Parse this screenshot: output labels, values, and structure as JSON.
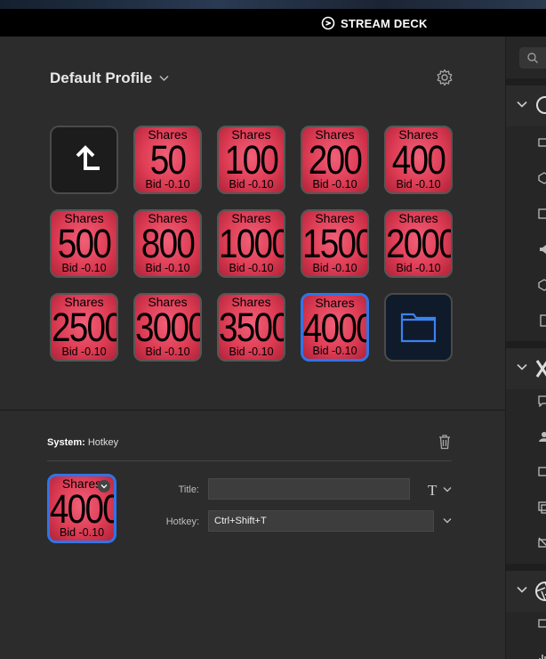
{
  "app": {
    "brand": "STREAM DECK"
  },
  "profile": {
    "name": "Default Profile"
  },
  "keys": [
    {
      "kind": "back"
    },
    {
      "kind": "share",
      "top": "Shares",
      "num": "50",
      "bottom": "Bid -0.10"
    },
    {
      "kind": "share",
      "top": "Shares",
      "num": "100",
      "bottom": "Bid -0.10"
    },
    {
      "kind": "share",
      "top": "Shares",
      "num": "200",
      "bottom": "Bid -0.10"
    },
    {
      "kind": "share",
      "top": "Shares",
      "num": "400",
      "bottom": "Bid -0.10"
    },
    {
      "kind": "share",
      "top": "Shares",
      "num": "500",
      "bottom": "Bid -0.10"
    },
    {
      "kind": "share",
      "top": "Shares",
      "num": "800",
      "bottom": "Bid -0.10"
    },
    {
      "kind": "share",
      "top": "Shares",
      "num": "1000",
      "bottom": "Bid -0.10"
    },
    {
      "kind": "share",
      "top": "Shares",
      "num": "1500",
      "bottom": "Bid -0.10"
    },
    {
      "kind": "share",
      "top": "Shares",
      "num": "2000",
      "bottom": "Bid -0.10"
    },
    {
      "kind": "share",
      "top": "Shares",
      "num": "2500",
      "bottom": "Bid -0.10"
    },
    {
      "kind": "share",
      "top": "Shares",
      "num": "3000",
      "bottom": "Bid -0.10"
    },
    {
      "kind": "share",
      "top": "Shares",
      "num": "3500",
      "bottom": "Bid -0.10"
    },
    {
      "kind": "share",
      "top": "Shares",
      "num": "4000",
      "bottom": "Bid -0.10",
      "selected": true
    },
    {
      "kind": "folder"
    }
  ],
  "inspector": {
    "category": "System:",
    "action": "Hotkey",
    "preview": {
      "top": "Shares",
      "num": "4000",
      "bottom": "Bid -0.10"
    },
    "title_label": "Title:",
    "title_value": "",
    "hotkey_label": "Hotkey:",
    "hotkey_value": "Ctrl+Shift+T",
    "title_format_glyph": "T"
  },
  "colors": {
    "accent": "#2f74e8",
    "key_red": "#de3d55",
    "background": "#2c2c2c"
  }
}
